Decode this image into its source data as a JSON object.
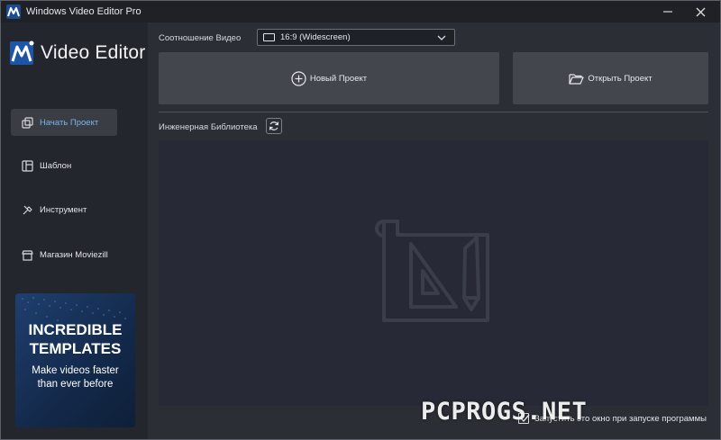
{
  "window": {
    "title": "Windows Video Editor Pro"
  },
  "brand": {
    "name": "Video Editor"
  },
  "sidebar": {
    "items": [
      {
        "label": "Начать Проект",
        "icon": "start-project-icon",
        "active": true
      },
      {
        "label": "Шаблон",
        "icon": "template-icon",
        "active": false
      },
      {
        "label": "Инструмент",
        "icon": "tool-icon",
        "active": false
      },
      {
        "label": "Магазин Moviezill",
        "icon": "store-icon",
        "active": false
      }
    ]
  },
  "promo": {
    "title_line1": "INCREDIBLE",
    "title_line2": "TEMPLATES",
    "sub_line1": "Make videos faster",
    "sub_line2": "than ever before"
  },
  "main": {
    "ratio_label": "Соотношение Видео",
    "ratio_value": "16:9 (Widescreen)",
    "new_project": "Новый Проект",
    "open_project": "Открыть Проект",
    "library_label": "Инженерная Библиотека",
    "startup_label": "Запустить это окно при запуске программы",
    "startup_checked": true
  },
  "watermark": "PCPROGS.NET",
  "colors": {
    "accent_blue": "#7ab4ee",
    "sidebar_bg": "#23262c",
    "main_bg": "#2b2e35",
    "button_bg": "#43464c",
    "library_bg": "#272a36"
  }
}
